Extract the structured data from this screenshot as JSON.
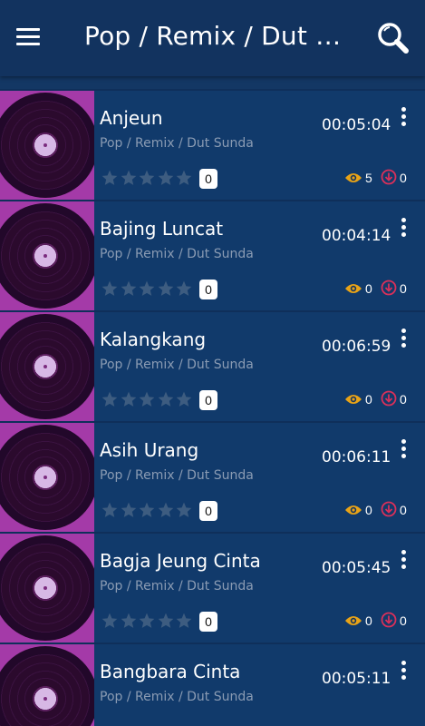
{
  "header": {
    "title": "Pop / Remix / Dut Sunda",
    "menu_icon": "hamburger-menu-icon",
    "search_icon": "search-icon"
  },
  "colors": {
    "appbar": "#12335f",
    "item_background": "#113a6b",
    "thumb_background": "#a43aa8",
    "star_empty": "#3d5c80",
    "views_icon": "#e8a317",
    "download_icon": "#d9305a"
  },
  "songs": [
    {
      "title": "Anjeun",
      "genre": "Pop / Remix / Dut Sunda",
      "duration": "00:05:04",
      "rating_count": "0",
      "views": "5",
      "downloads": "0"
    },
    {
      "title": "Bajing Luncat",
      "genre": "Pop / Remix / Dut Sunda",
      "duration": "00:04:14",
      "rating_count": "0",
      "views": "0",
      "downloads": "0"
    },
    {
      "title": "Kalangkang",
      "genre": "Pop / Remix / Dut Sunda",
      "duration": "00:06:59",
      "rating_count": "0",
      "views": "0",
      "downloads": "0"
    },
    {
      "title": "Asih Urang",
      "genre": "Pop / Remix / Dut Sunda",
      "duration": "00:06:11",
      "rating_count": "0",
      "views": "0",
      "downloads": "0"
    },
    {
      "title": "Bagja Jeung Cinta",
      "genre": "Pop / Remix / Dut Sunda",
      "duration": "00:05:45",
      "rating_count": "0",
      "views": "0",
      "downloads": "0"
    },
    {
      "title": "Bangbara Cinta",
      "genre": "Pop / Remix / Dut Sunda",
      "duration": "00:05:11",
      "rating_count": "",
      "views": "",
      "downloads": ""
    }
  ]
}
